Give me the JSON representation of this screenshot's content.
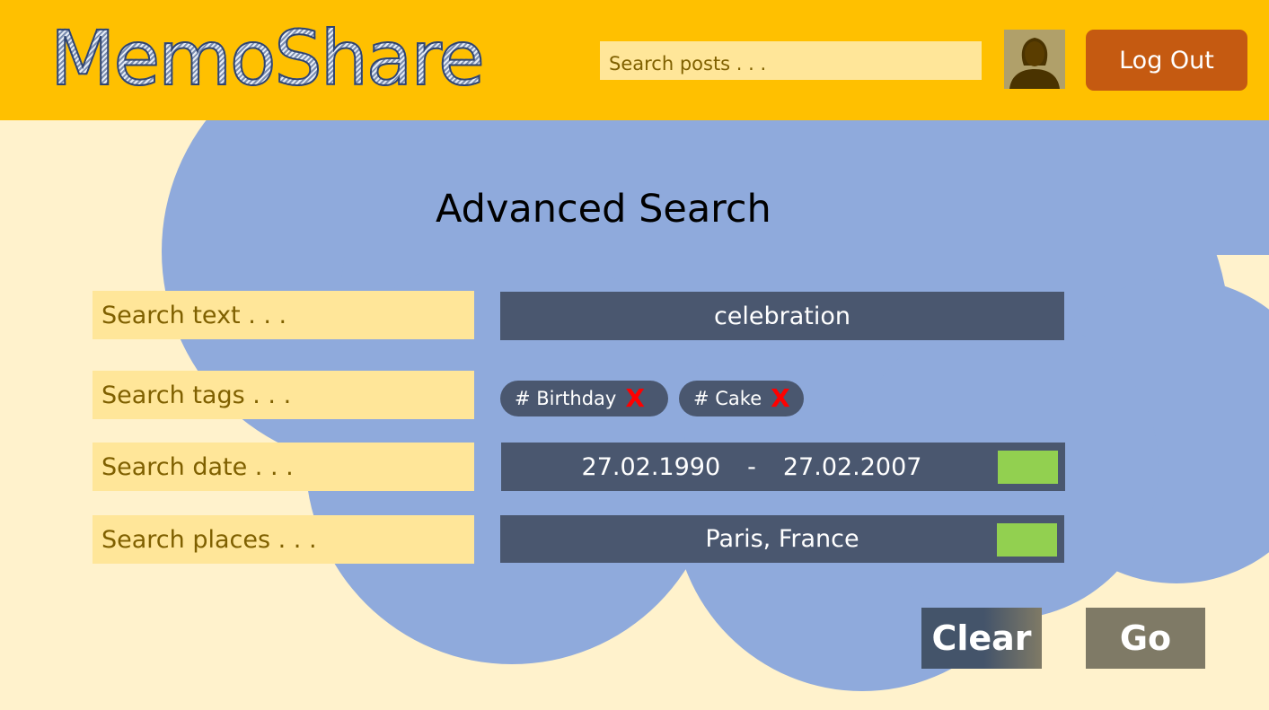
{
  "header": {
    "logo": "MemoShare",
    "search_placeholder": "Search posts . . .",
    "logout_label": "Log Out"
  },
  "main": {
    "title": "Advanced Search",
    "rows": {
      "text": {
        "label": "Search text . . .",
        "value": "celebration"
      },
      "tags": {
        "label": "Search tags . . .",
        "items": [
          {
            "text": "# Birthday",
            "remove": "X"
          },
          {
            "text": "# Cake",
            "remove": "X"
          }
        ]
      },
      "date": {
        "label": "Search date . . .",
        "from": "27.02.1990",
        "separator": "-",
        "to": "27.02.2007"
      },
      "places": {
        "label": "Search places . . .",
        "value": "Paris, France"
      }
    },
    "clear_label": "Clear",
    "go_label": "Go"
  },
  "colors": {
    "header_bg": "#ffc000",
    "page_bg": "#fff2cc",
    "cloud": "#8faadc",
    "field_bg": "#4a576f",
    "label_bg": "#ffe699",
    "logout_bg": "#c55a11",
    "toggle": "#92d050",
    "remove": "#ff0000"
  }
}
